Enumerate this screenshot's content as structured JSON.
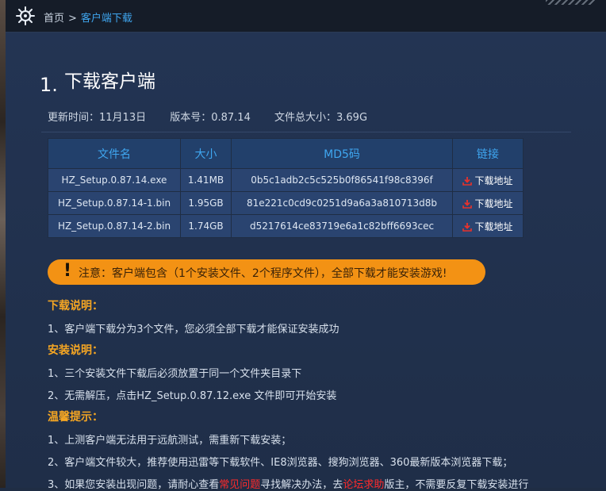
{
  "breadcrumb": {
    "home": "首页",
    "separator": ">",
    "current": "客户端下载"
  },
  "section": {
    "number": "1.",
    "title": "下载客户端"
  },
  "meta": {
    "update_time": "更新时间：11月13日",
    "version": "版本号：0.87.14",
    "total_size": "文件总大小：3.69G"
  },
  "table": {
    "headers": [
      "文件名",
      "大小",
      "MD5码",
      "链接"
    ],
    "rows": [
      {
        "name": "HZ_Setup.0.87.14.exe",
        "size": "1.41MB",
        "md5": "0b5c1adb2c5c525b0f86541f98c8396f",
        "link": "下载地址"
      },
      {
        "name": "HZ_Setup.0.87.14-1.bin",
        "size": "1.95GB",
        "md5": "81e221c0cd9c0251d9a6a3a810713d8b",
        "link": "下载地址"
      },
      {
        "name": "HZ_Setup.0.87.14-2.bin",
        "size": "1.74GB",
        "md5": "d5217614ce83719e6a1c82bff6693cec",
        "link": "下载地址"
      }
    ]
  },
  "notice": {
    "mark": "!",
    "text": "注意：客户端包含（1个安装文件、2个程序文件），全部下载才能安装游戏!"
  },
  "download_notes": {
    "title": "下载说明：",
    "items": [
      "1、客户端下载分为3个文件，您必须全部下载才能保证安装成功"
    ]
  },
  "install_notes": {
    "title": "安装说明：",
    "items": [
      "1、三个安装文件下载后必须放置于同一个文件夹目录下",
      "2、无需解压，点击HZ_Setup.0.87.12.exe 文件即可开始安装"
    ]
  },
  "tips": {
    "title": "温馨提示：",
    "item1": "1、上测客户端无法用于远航测试，需重新下载安装；",
    "item2": "2、客户端文件较大，推荐使用迅雷等下载软件、IE8浏览器、搜狗浏览器、360最新版本浏览器下载；",
    "item3": {
      "part1": "3、如果您安装出现问题，请耐心查看",
      "link1": "常见问题",
      "part2": "寻找解决办法，去",
      "link2": "论坛求助",
      "part3": "版主，不需要反复下载安装进行"
    }
  },
  "colors": {
    "accent_blue": "#3fa6f0",
    "notice_orange": "#f39214",
    "heading_orange": "#f5a623",
    "link_red": "#ff2a2a"
  }
}
